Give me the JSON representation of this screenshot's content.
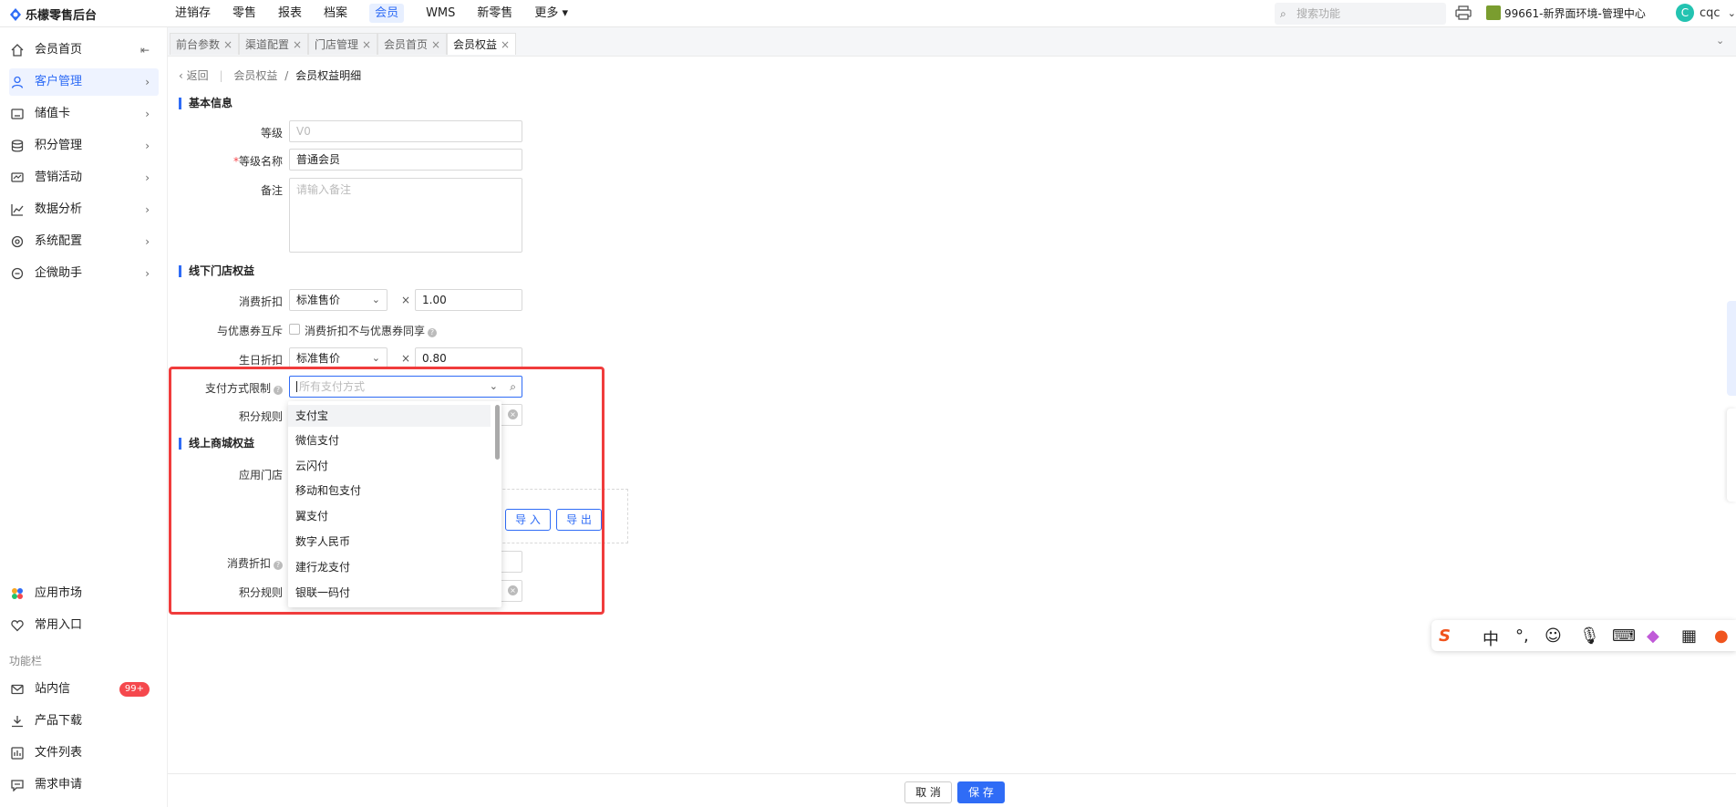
{
  "app": {
    "title": "乐檬零售后台"
  },
  "nav": {
    "items": [
      "进销存",
      "零售",
      "报表",
      "档案",
      "会员",
      "WMS",
      "新零售",
      "更多 ▾"
    ],
    "active": 4
  },
  "header": {
    "search_placeholder": "搜索功能",
    "store": "99661-新界面环境-管理中心",
    "user_initial": "C",
    "user_name": "cqc"
  },
  "sidebar": {
    "items": [
      {
        "label": "会员首页",
        "icon": "home-icon"
      },
      {
        "label": "客户管理",
        "icon": "user-icon"
      },
      {
        "label": "储值卡",
        "icon": "card-icon"
      },
      {
        "label": "积分管理",
        "icon": "coins-icon"
      },
      {
        "label": "营销活动",
        "icon": "campaign-icon"
      },
      {
        "label": "数据分析",
        "icon": "chart-icon"
      },
      {
        "label": "系统配置",
        "icon": "gear-icon"
      },
      {
        "label": "企微助手",
        "icon": "chat-icon"
      }
    ],
    "bottom": [
      {
        "label": "应用市场",
        "icon": "apps-icon"
      },
      {
        "label": "常用入口",
        "icon": "heart-icon"
      }
    ],
    "caption": "功能栏",
    "tools": [
      {
        "label": "站内信",
        "icon": "mail-icon",
        "badge": "99+"
      },
      {
        "label": "产品下载",
        "icon": "download-icon"
      },
      {
        "label": "文件列表",
        "icon": "file-list-icon"
      },
      {
        "label": "需求申请",
        "icon": "request-icon"
      }
    ]
  },
  "tabs": [
    "前台参数",
    "渠道配置",
    "门店管理",
    "会员首页",
    "会员权益"
  ],
  "breadcrumb": {
    "back": "返回",
    "parent": "会员权益",
    "separator": "/",
    "current": "会员权益明细"
  },
  "basic": {
    "title": "基本信息",
    "level_label": "等级",
    "level_value": "V0",
    "name_label": "等级名称",
    "name_value": "普通会员",
    "remark_label": "备注",
    "remark_placeholder": "请输入备注"
  },
  "offline": {
    "title": "线下门店权益",
    "discount_label": "消费折扣",
    "discount_price": "标准售价",
    "discount_rate": "1.00",
    "coupon_label": "与优惠券互斥",
    "coupon_check": "消费折扣不与优惠券同享",
    "birthday_label": "生日折扣",
    "birthday_price": "标准售价",
    "birthday_rate": "0.80",
    "pay_label": "支付方式限制",
    "pay_placeholder": "所有支付方式",
    "points_label": "积分规则"
  },
  "online": {
    "title": "线上商城权益",
    "store_label": "应用门店",
    "import": "导 入",
    "export": "导 出",
    "discount_label": "消费折扣",
    "points_label": "积分规则"
  },
  "times_sign": "×",
  "dropdown": [
    "支付宝",
    "微信支付",
    "云闪付",
    "移动和包支付",
    "翼支付",
    "数字人民币",
    "建行龙支付",
    "银联一码付"
  ],
  "footer": {
    "cancel": "取 消",
    "save": "保 存"
  },
  "ime": [
    "中",
    "°,"
  ]
}
